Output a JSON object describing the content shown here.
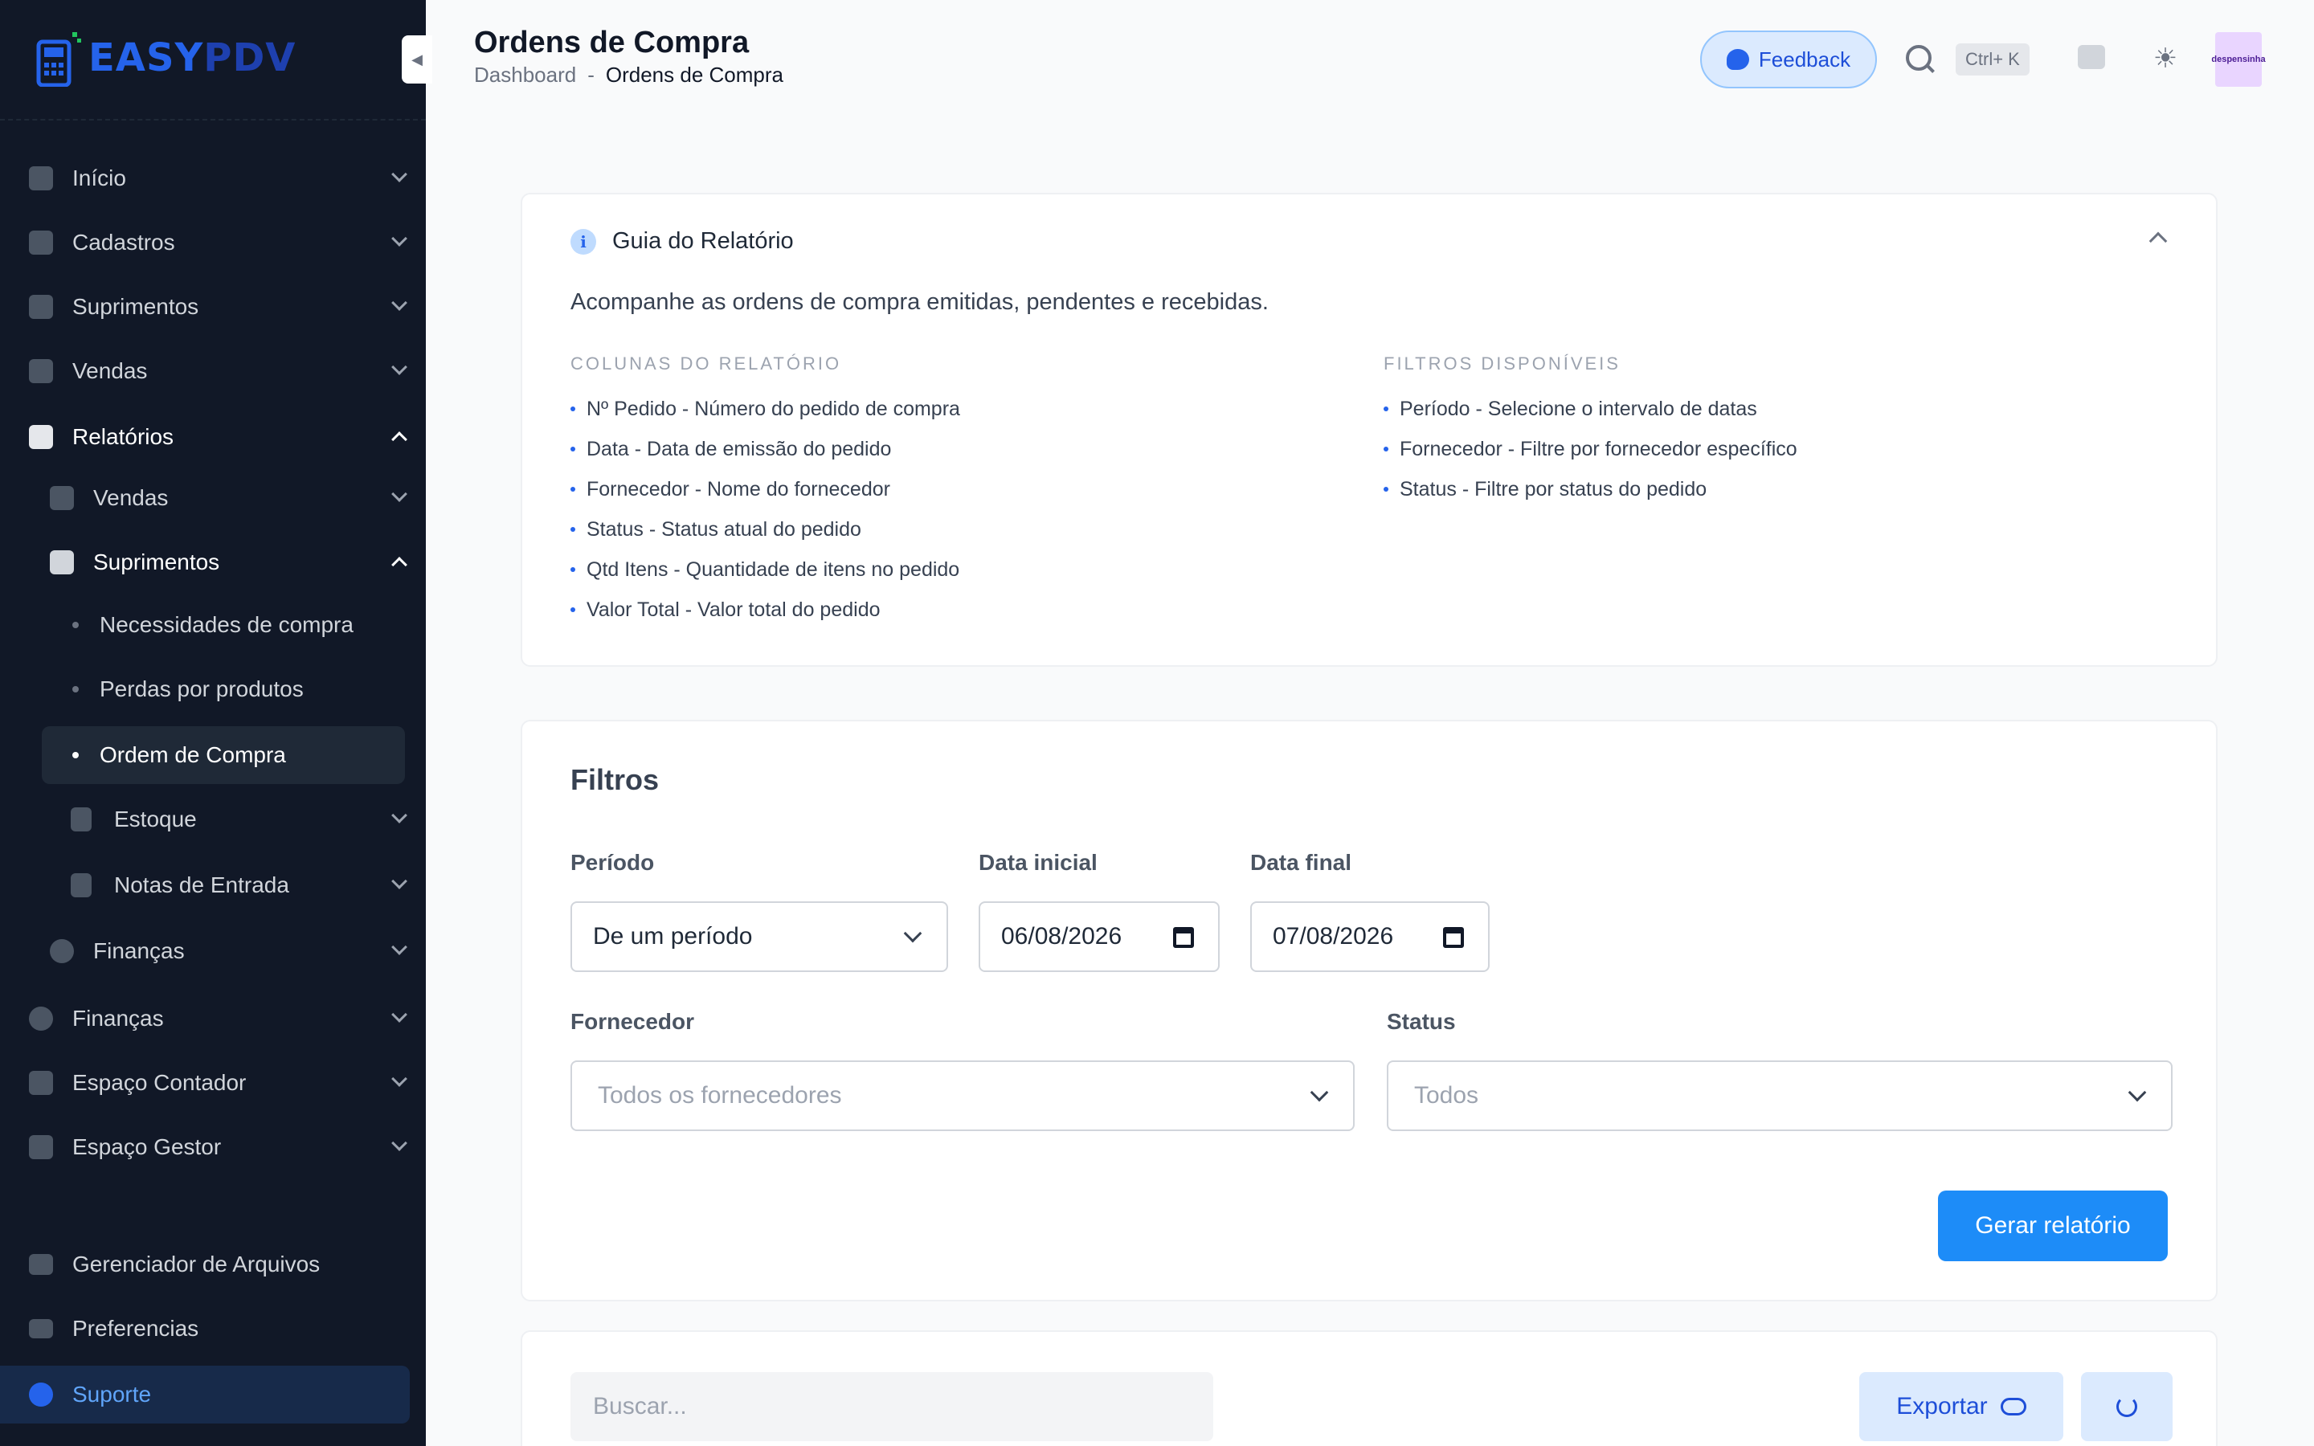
{
  "app": {
    "logo_text_1": "EASY",
    "logo_text_2": "PDV"
  },
  "sidebar": {
    "items": [
      {
        "label": "Início"
      },
      {
        "label": "Cadastros"
      },
      {
        "label": "Suprimentos"
      },
      {
        "label": "Vendas"
      },
      {
        "label": "Relatórios"
      },
      {
        "label": "Vendas"
      },
      {
        "label": "Suprimentos"
      },
      {
        "label": "Necessidades de compra"
      },
      {
        "label": "Perdas por produtos"
      },
      {
        "label": "Ordem de Compra"
      },
      {
        "label": "Estoque"
      },
      {
        "label": "Notas de Entrada"
      },
      {
        "label": "Finanças"
      },
      {
        "label": "Finanças"
      },
      {
        "label": "Espaço Contador"
      },
      {
        "label": "Espaço Gestor"
      },
      {
        "label": "Gerenciador de Arquivos"
      },
      {
        "label": "Preferencias"
      },
      {
        "label": "Suporte"
      }
    ]
  },
  "header": {
    "title": "Ordens de Compra",
    "breadcrumb": [
      "Dashboard",
      "-",
      "Ordens de Compra"
    ],
    "feedback_label": "Feedback",
    "shortcut": "Ctrl+ K",
    "avatar_text": "despensinha"
  },
  "guide": {
    "title": "Guia do Relatório",
    "description": "Acompanhe as ordens de compra emitidas, pendentes e recebidas.",
    "columns_heading": "COLUNAS DO RELATÓRIO",
    "columns": [
      "Nº Pedido - Número do pedido de compra",
      "Data - Data de emissão do pedido",
      "Fornecedor - Nome do fornecedor",
      "Status - Status atual do pedido",
      "Qtd Itens - Quantidade de itens no pedido",
      "Valor Total - Valor total do pedido"
    ],
    "filters_heading": "FILTROS DISPONÍVEIS",
    "filters": [
      "Período - Selecione o intervalo de datas",
      "Fornecedor - Filtre por fornecedor específico",
      "Status - Filtre por status do pedido"
    ]
  },
  "filters": {
    "title": "Filtros",
    "period_label": "Período",
    "period_value": "De um período",
    "start_label": "Data inicial",
    "start_value": "06/08/2026",
    "end_label": "Data final",
    "end_value": "07/08/2026",
    "supplier_label": "Fornecedor",
    "supplier_value": "Todos os fornecedores",
    "status_label": "Status",
    "status_value": "Todos",
    "generate_label": "Gerar relatório"
  },
  "results": {
    "search_placeholder": "Buscar...",
    "export_label": "Exportar"
  }
}
